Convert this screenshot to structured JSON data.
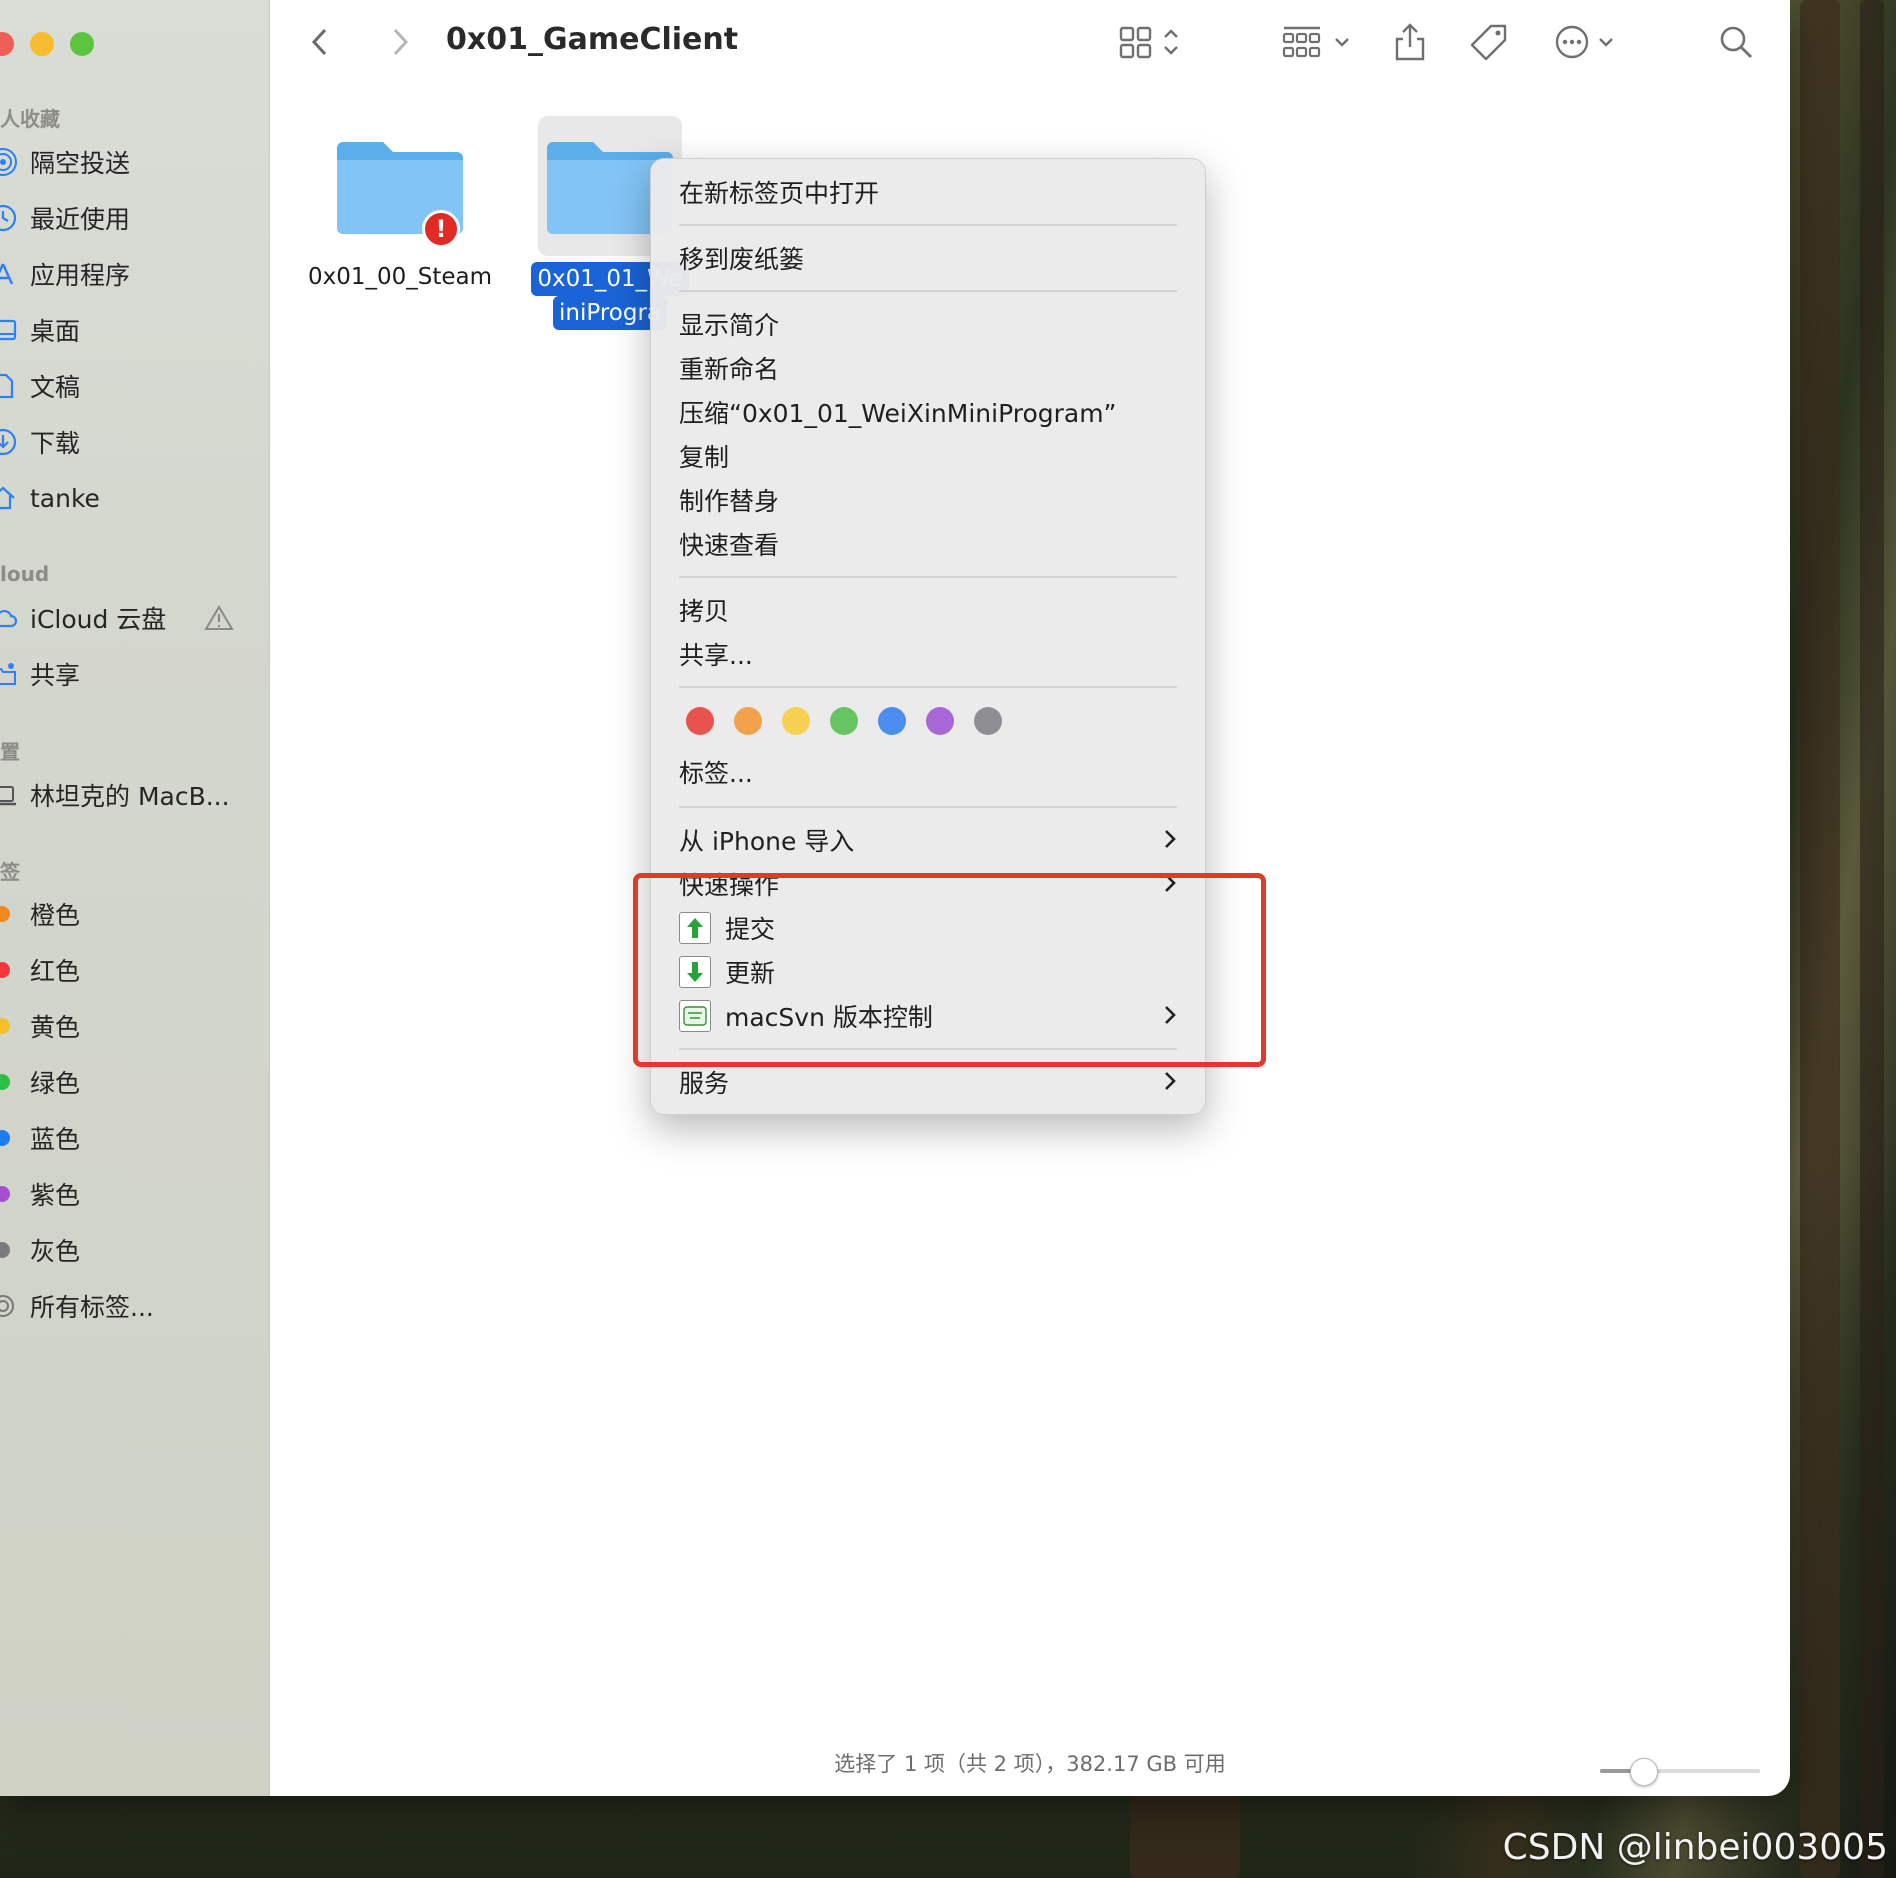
{
  "window": {
    "title": "0x01_GameClient"
  },
  "sidebar": {
    "sections": [
      {
        "heading": "人收藏",
        "items": [
          {
            "label": "隔空投送",
            "icon": "airdrop-icon"
          },
          {
            "label": "最近使用",
            "icon": "clock-icon"
          },
          {
            "label": "应用程序",
            "icon": "applications-icon"
          },
          {
            "label": "桌面",
            "icon": "desktop-icon"
          },
          {
            "label": "文稿",
            "icon": "document-icon"
          },
          {
            "label": "下载",
            "icon": "download-icon"
          },
          {
            "label": "tanke",
            "icon": "home-icon"
          }
        ]
      },
      {
        "heading": "loud",
        "items": [
          {
            "label": "iCloud 云盘",
            "icon": "cloud-icon"
          },
          {
            "label": "共享",
            "icon": "shared-folder-icon"
          }
        ]
      },
      {
        "heading": "置",
        "items": [
          {
            "label": "林坦克的 MacB...",
            "icon": "laptop-icon"
          }
        ]
      },
      {
        "heading": "签",
        "items": [
          {
            "label": "橙色",
            "color": "#f08a1c"
          },
          {
            "label": "红色",
            "color": "#f3383c"
          },
          {
            "label": "黄色",
            "color": "#f3c12a"
          },
          {
            "label": "绿色",
            "color": "#2dbf43"
          },
          {
            "label": "蓝色",
            "color": "#1e7cf5"
          },
          {
            "label": "紫色",
            "color": "#a550d0"
          },
          {
            "label": "灰色",
            "color": "#7b7b7e"
          },
          {
            "label": "所有标签...",
            "icon": "all-tags-icon"
          }
        ]
      }
    ]
  },
  "files": [
    {
      "name": "0x01_00_Steam",
      "badge": "!",
      "selected": false
    },
    {
      "name_line1": "0x01_01_We",
      "name_line2": "iniProgra",
      "selected": true
    }
  ],
  "context_menu": {
    "group1": [
      "在新标签页中打开"
    ],
    "group2": [
      "移到废纸篓"
    ],
    "group3": [
      "显示简介",
      "重新命名",
      "压缩“0x01_01_WeiXinMiniProgram”",
      "复制",
      "制作替身",
      "快速查看"
    ],
    "group4": [
      "拷贝",
      "共享..."
    ],
    "tag_colors": [
      "#e9534d",
      "#f2a24b",
      "#f6d052",
      "#67c663",
      "#4c8ef0",
      "#a866d6",
      "#8e8e93"
    ],
    "tags_label": "标签...",
    "import_label": "从 iPhone 导入",
    "quick_actions_label": "快速操作",
    "commit_label": "提交",
    "update_label": "更新",
    "macsvn_label": "macSvn 版本控制",
    "services_label": "服务"
  },
  "status": {
    "text": "选择了 1 项（共 2 项），382.17 GB 可用",
    "zoom_slider_fraction": 0.27
  },
  "watermark": "CSDN @linbei003005"
}
